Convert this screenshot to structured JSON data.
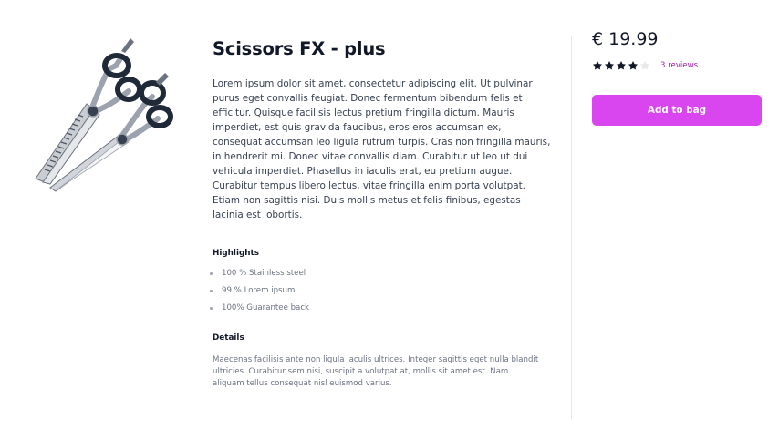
{
  "product": {
    "title": "Scissors FX - plus",
    "description": "Lorem ipsum dolor sit amet, consectetur adipiscing elit. Ut pulvinar purus eget convallis feugiat. Donec fermentum bibendum felis et efficitur. Quisque facilisis lectus pretium fringilla dictum. Mauris imperdiet, est quis gravida faucibus, eros eros accumsan ex, consequat accumsan leo ligula rutrum turpis. Cras non fringilla mauris, in hendrerit mi. Donec vitae convallis diam. Curabitur ut leo ut dui vehicula imperdiet. Phasellus in iaculis erat, eu pretium augue. Curabitur tempus libero lectus, vitae fringilla enim porta volutpat. Etiam non sagittis nisi. Duis mollis metus et felis finibus, egestas lacinia est lobortis.",
    "image_icon": "scissors-image"
  },
  "highlights": {
    "heading": "Highlights",
    "items": [
      "100 % Stainless steel",
      "99 % Lorem ipsum",
      "100% Guarantee back"
    ]
  },
  "details": {
    "heading": "Details",
    "text": "Maecenas facilisis ante non ligula iaculis ultrices. Integer sagittis eget nulla blandit ultricies. Curabitur sem nisi, suscipit a volutpat at, mollis sit amet est. Nam aliquam tellus consequat nisl euismod varius."
  },
  "purchase": {
    "price": "€ 19.99",
    "rating": 4,
    "rating_max": 5,
    "reviews_label": "3 reviews",
    "add_to_bag_label": "Add to bag"
  },
  "colors": {
    "accent": "#d946ef",
    "link": "#a21caf",
    "star_filled": "#111827",
    "star_empty": "#e5e7eb"
  }
}
